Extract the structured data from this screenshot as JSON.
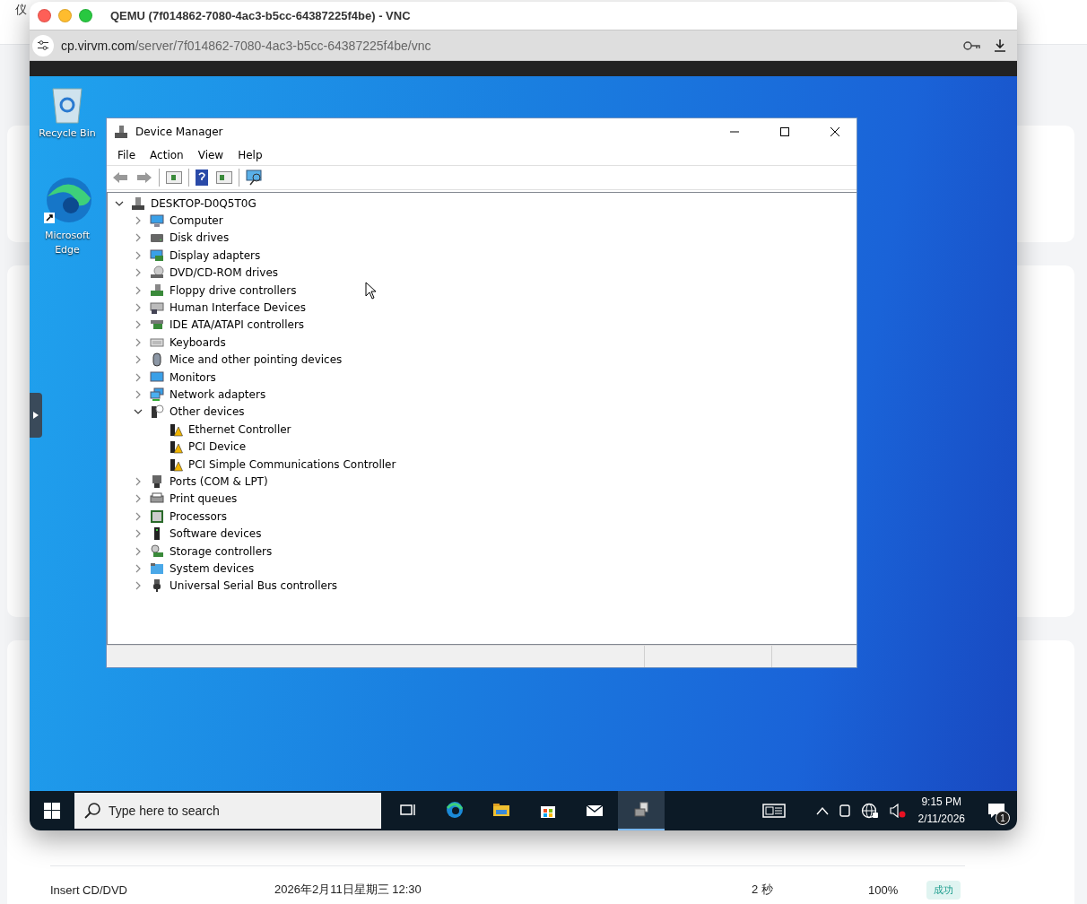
{
  "background_page": {
    "heading": "仪",
    "rows": [
      {
        "name": "Insert CD/DVD",
        "time": "2026年2月11日星期三 12:30",
        "duration": "2 秒",
        "progress": "100%",
        "status": "成功"
      }
    ]
  },
  "browser": {
    "title": "QEMU (7f014862-7080-4ac3-b5cc-64387225f4be) - VNC",
    "url_host": "cp.virvm.com",
    "url_path": "/server/7f014862-7080-4ac3-b5cc-64387225f4be/vnc"
  },
  "desktop": {
    "icons": [
      {
        "label": "Recycle Bin"
      },
      {
        "label": "Microsoft Edge"
      }
    ]
  },
  "device_manager": {
    "title": "Device Manager",
    "menu": [
      "File",
      "Action",
      "View",
      "Help"
    ],
    "tree": {
      "label": "DESKTOP-D0Q5T0G",
      "kind": "computer",
      "expanded": true,
      "children": [
        {
          "label": "Computer",
          "kind": "category",
          "expanded": false
        },
        {
          "label": "Disk drives",
          "kind": "category",
          "expanded": false
        },
        {
          "label": "Display adapters",
          "kind": "category",
          "expanded": false
        },
        {
          "label": "DVD/CD-ROM drives",
          "kind": "category",
          "expanded": false
        },
        {
          "label": "Floppy drive controllers",
          "kind": "category",
          "expanded": false
        },
        {
          "label": "Human Interface Devices",
          "kind": "category",
          "expanded": false
        },
        {
          "label": "IDE ATA/ATAPI controllers",
          "kind": "category",
          "expanded": false
        },
        {
          "label": "Keyboards",
          "kind": "category",
          "expanded": false
        },
        {
          "label": "Mice and other pointing devices",
          "kind": "category",
          "expanded": false
        },
        {
          "label": "Monitors",
          "kind": "category",
          "expanded": false
        },
        {
          "label": "Network adapters",
          "kind": "category",
          "expanded": false
        },
        {
          "label": "Other devices",
          "kind": "category",
          "expanded": true,
          "children": [
            {
              "label": "Ethernet Controller",
              "kind": "unknown-device"
            },
            {
              "label": "PCI Device",
              "kind": "unknown-device"
            },
            {
              "label": "PCI Simple Communications Controller",
              "kind": "unknown-device"
            }
          ]
        },
        {
          "label": "Ports (COM & LPT)",
          "kind": "category",
          "expanded": false
        },
        {
          "label": "Print queues",
          "kind": "category",
          "expanded": false
        },
        {
          "label": "Processors",
          "kind": "category",
          "expanded": false
        },
        {
          "label": "Software devices",
          "kind": "category",
          "expanded": false
        },
        {
          "label": "Storage controllers",
          "kind": "category",
          "expanded": false
        },
        {
          "label": "System devices",
          "kind": "category",
          "expanded": false
        },
        {
          "label": "Universal Serial Bus controllers",
          "kind": "category",
          "expanded": false
        }
      ]
    }
  },
  "taskbar": {
    "search": {
      "placeholder": "Type here to search"
    },
    "apps": [
      {
        "selected": false
      },
      {
        "selected": false
      },
      {
        "selected": false
      },
      {
        "selected": false
      },
      {
        "selected": false
      },
      {
        "selected": true
      }
    ],
    "time": "9:15 PM",
    "date": "2/11/2026",
    "notifications": "1"
  }
}
